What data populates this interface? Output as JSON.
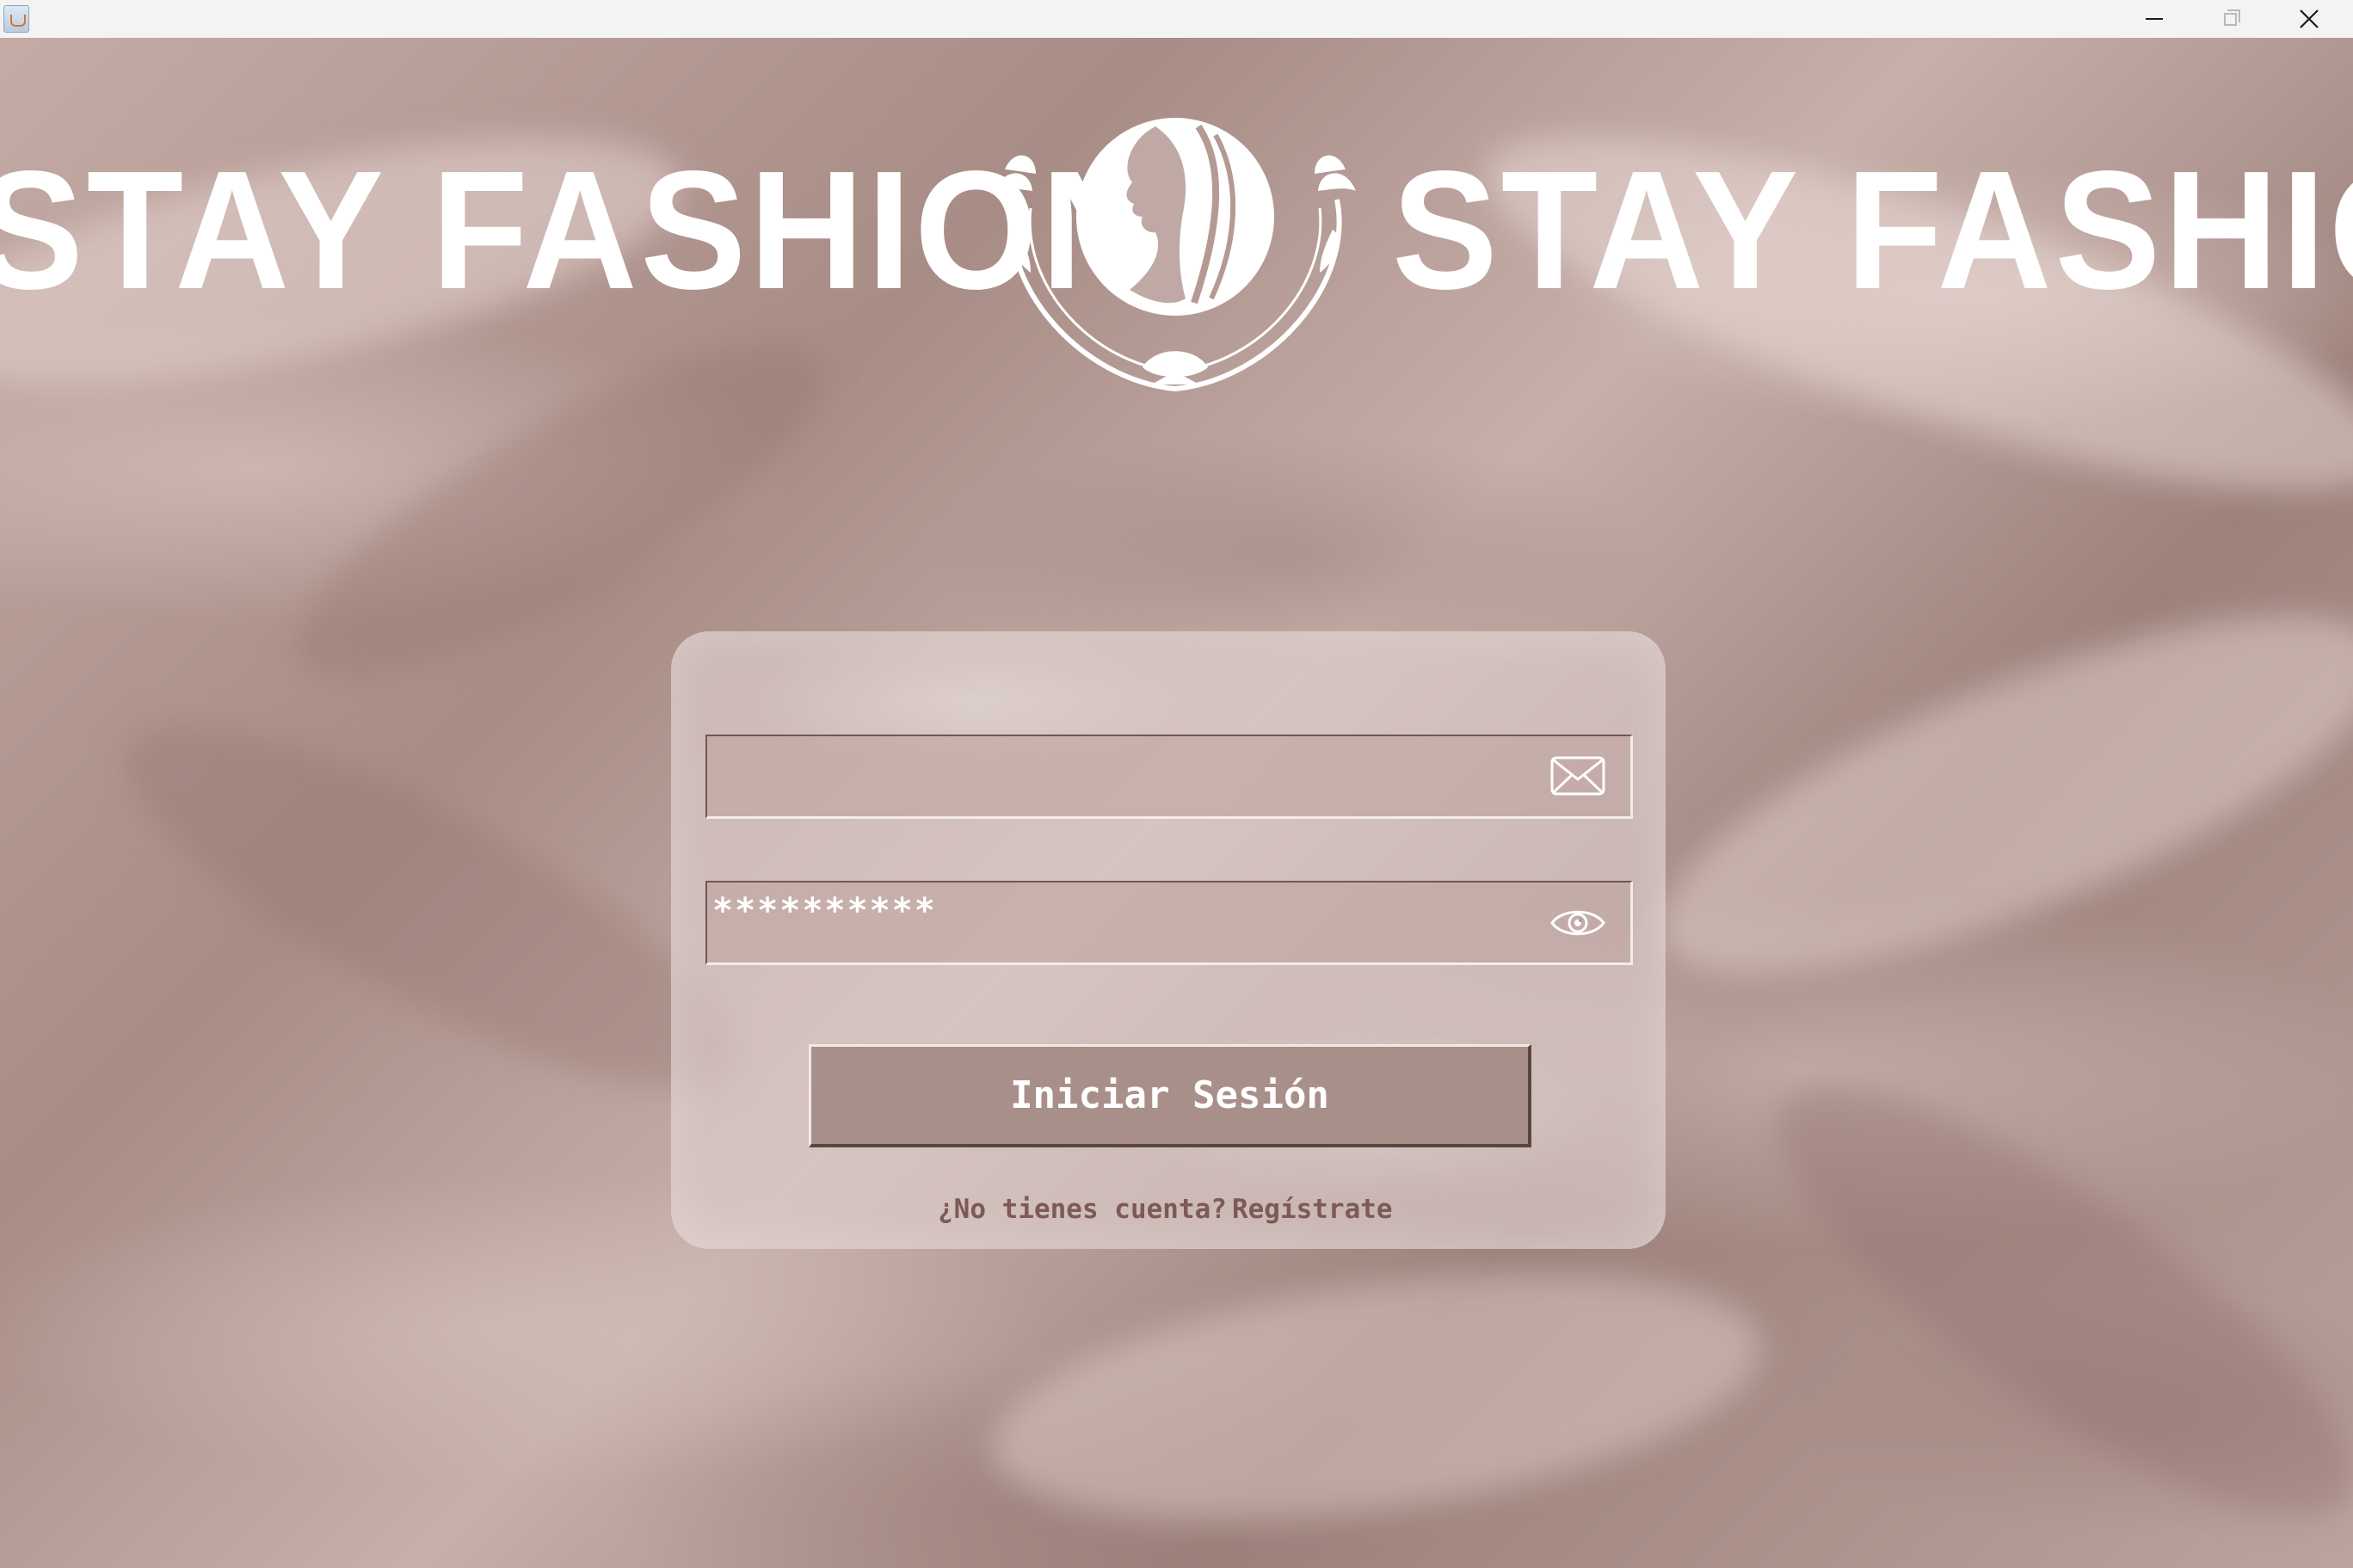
{
  "window": {
    "title": "",
    "icon": "java-app-icon",
    "controls": [
      "minimize-icon",
      "maximize-icon",
      "close-icon"
    ]
  },
  "brand": {
    "left_text": "STAY FASHION",
    "right_text": "STAY FASHION",
    "logo_icon": "woman-profile-laurel-logo"
  },
  "login": {
    "email": {
      "value": "",
      "icon": "envelope-icon"
    },
    "password": {
      "masked_value": "**********",
      "icon": "eye-icon"
    },
    "submit_label": "Iniciar Sesión",
    "register_prompt": "¿No tienes cuenta?",
    "register_link": "Regístrate"
  },
  "colors": {
    "background": "#b59a94",
    "button": "#a98f8a",
    "register_text": "#7e5a55",
    "brand_text": "#ffffff"
  }
}
